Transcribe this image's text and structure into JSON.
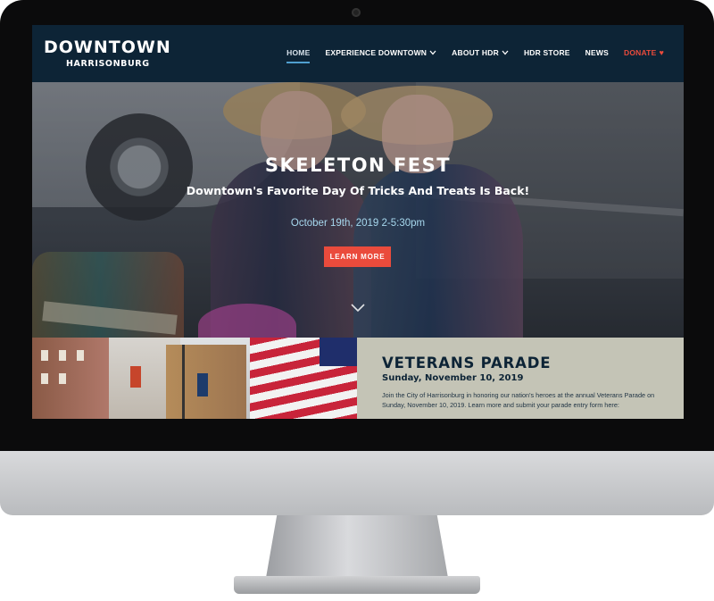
{
  "header": {
    "logo_main": "DOWNTOWN",
    "logo_sub": "HARRISONBURG",
    "nav": [
      {
        "label": "HOME"
      },
      {
        "label": "EXPERIENCE DOWNTOWN"
      },
      {
        "label": "ABOUT HDR"
      },
      {
        "label": "HDR STORE"
      },
      {
        "label": "NEWS"
      },
      {
        "label": "DONATE"
      }
    ]
  },
  "hero": {
    "title": "SKELETON FEST",
    "subtitle": "Downtown's Favorite Day Of Tricks And Treats Is Back!",
    "date": "October 19th, 2019 2-5:30pm",
    "button_label": "LEARN MORE"
  },
  "feature": {
    "title": "VETERANS PARADE",
    "date": "Sunday, November 10, 2019",
    "body": "Join the City of Harrisonburg in honoring our nation's heroes at the annual Veterans Parade on Sunday, November 10, 2019. Learn more and submit your parade entry form here:"
  },
  "colors": {
    "navy": "#0d2436",
    "accent_red": "#ea4b3c",
    "date_blue": "#a7d8ee",
    "feature_bg": "#c4c4b6"
  },
  "icons": {
    "nav_dropdown": "chevron-down-icon",
    "donate": "heart-icon",
    "scroll": "chevron-down-icon"
  }
}
